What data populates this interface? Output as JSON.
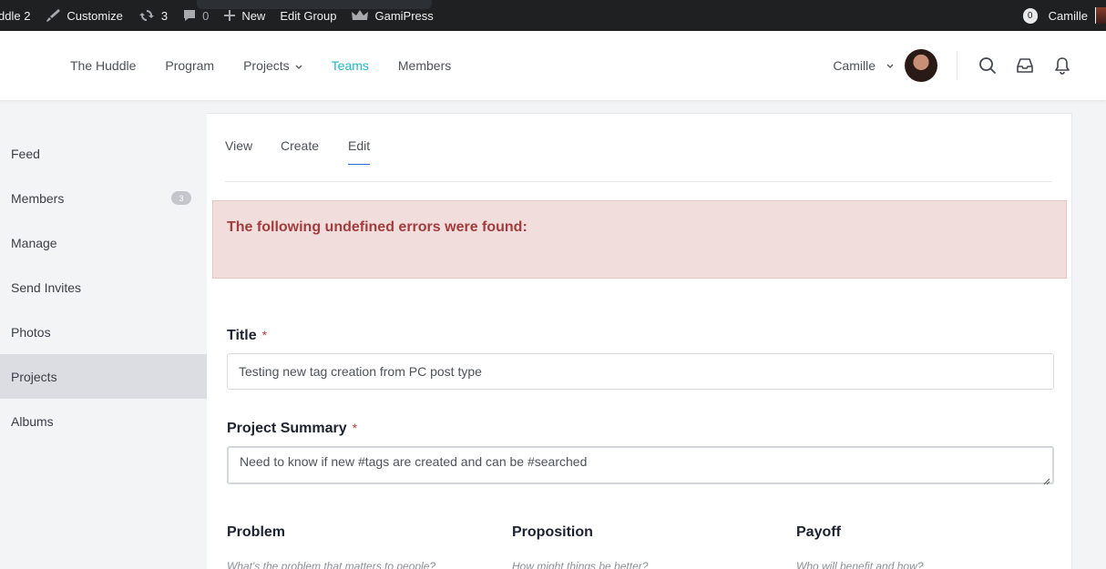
{
  "adminbar": {
    "site_name": "ddle 2",
    "customize": "Customize",
    "updates_count": "3",
    "comments_count": "0",
    "new_label": "New",
    "edit_group": "Edit Group",
    "gamipress": "GamiPress",
    "notif_count": "0",
    "user": "Camille"
  },
  "header": {
    "nav": [
      "The Huddle",
      "Program",
      "Projects",
      "Teams",
      "Members"
    ],
    "active_nav": "Teams",
    "user": "Camille"
  },
  "sidebar": {
    "items": [
      {
        "label": "Feed"
      },
      {
        "label": "Members",
        "count": "3"
      },
      {
        "label": "Manage"
      },
      {
        "label": "Send Invites"
      },
      {
        "label": "Photos"
      },
      {
        "label": "Projects"
      },
      {
        "label": "Albums"
      }
    ],
    "active": "Projects"
  },
  "tabs": [
    "View",
    "Create",
    "Edit"
  ],
  "active_tab": "Edit",
  "error": {
    "message": "The following undefined errors were found:"
  },
  "form": {
    "title_label": "Title",
    "title_value": "Testing new tag creation from PC post type",
    "summary_label": "Project Summary",
    "summary_value": "Need to know if new #tags are created and can be #searched",
    "required_mark": "*",
    "columns": [
      {
        "label": "Problem",
        "hint": "What's the problem that matters to people?"
      },
      {
        "label": "Proposition",
        "hint": "How might things be better?"
      },
      {
        "label": "Payoff",
        "hint": "Who will benefit and how?"
      }
    ]
  },
  "colors": {
    "accent": "#1fb6c9",
    "error_bg": "#f2dddd",
    "error_text": "#a33c3c",
    "tab_underline": "#1f6fd1"
  }
}
